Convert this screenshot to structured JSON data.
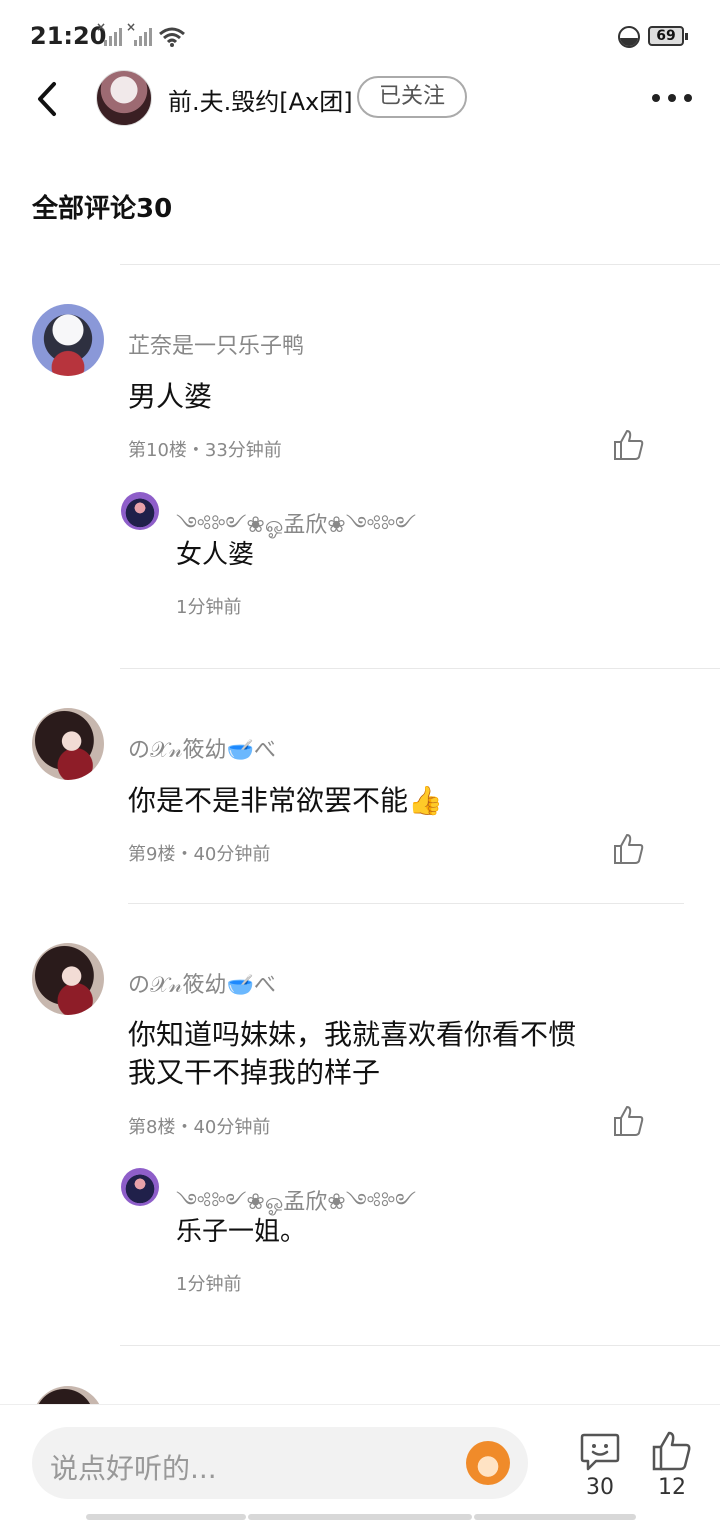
{
  "status_bar": {
    "time": "21:20",
    "battery": "69"
  },
  "header": {
    "name": "前.夫.毁约[Ax团]",
    "follow_label": "已关注"
  },
  "section_title": "全部评论30",
  "comments": [
    {
      "user": "芷奈是一只乐子鸭",
      "text": "男人婆",
      "meta": "第10楼・33分钟前",
      "reply": {
        "user": "༺༻❀ஓ孟欣❀༺༻",
        "text": "女人婆",
        "meta": "1分钟前"
      }
    },
    {
      "user": "の𝒳𝓃筱幼🥣べ",
      "text": "你是不是非常欲罢不能👍",
      "meta": "第9楼・40分钟前"
    },
    {
      "user": "の𝒳𝓃筱幼🥣べ",
      "text_line1": "你知道吗妹妹，我就喜欢看你看不惯",
      "text_line2": "我又干不掉我的样子",
      "meta": "第8楼・40分钟前",
      "reply": {
        "user": "༺༻❀ஓ孟欣❀༺༻",
        "text": "乐子一姐。",
        "meta": "1分钟前"
      }
    }
  ],
  "bottom_bar": {
    "placeholder": "说点好听的...",
    "comment_count": "30",
    "like_count": "12"
  },
  "icons": {
    "back": "chevron-left-icon",
    "more": "more-icon",
    "like": "thumbs-up-icon",
    "comment": "comment-bubble-icon",
    "emoji": "monkey-emoji-icon"
  }
}
